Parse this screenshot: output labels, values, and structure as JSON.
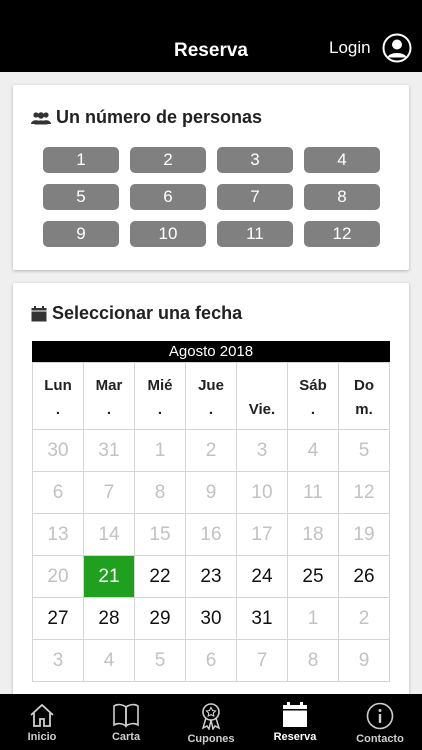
{
  "header": {
    "title": "Reserva",
    "login": "Login"
  },
  "people_section": {
    "title": "Un número de personas",
    "options": [
      "1",
      "2",
      "3",
      "4",
      "5",
      "6",
      "7",
      "8",
      "9",
      "10",
      "11",
      "12"
    ]
  },
  "date_section": {
    "title": "Seleccionar una fecha",
    "month": "Agosto 2018",
    "weekdays": [
      {
        "l1": "Lun",
        "l2": "."
      },
      {
        "l1": "Mar",
        "l2": "."
      },
      {
        "l1": "Mié",
        "l2": "."
      },
      {
        "l1": "Jue",
        "l2": "."
      },
      {
        "l1": "",
        "l2": "Vie."
      },
      {
        "l1": "Sáb",
        "l2": "."
      },
      {
        "l1": "Do",
        "l2": "m."
      }
    ],
    "weeks": [
      [
        {
          "d": "30",
          "s": "dim"
        },
        {
          "d": "31",
          "s": "dim"
        },
        {
          "d": "1",
          "s": "dim"
        },
        {
          "d": "2",
          "s": "dim"
        },
        {
          "d": "3",
          "s": "dim"
        },
        {
          "d": "4",
          "s": "dim"
        },
        {
          "d": "5",
          "s": "dim"
        }
      ],
      [
        {
          "d": "6",
          "s": "dim"
        },
        {
          "d": "7",
          "s": "dim"
        },
        {
          "d": "8",
          "s": "dim"
        },
        {
          "d": "9",
          "s": "dim"
        },
        {
          "d": "10",
          "s": "dim"
        },
        {
          "d": "11",
          "s": "dim"
        },
        {
          "d": "12",
          "s": "dim"
        }
      ],
      [
        {
          "d": "13",
          "s": "dim"
        },
        {
          "d": "14",
          "s": "dim"
        },
        {
          "d": "15",
          "s": "dim"
        },
        {
          "d": "16",
          "s": "dim"
        },
        {
          "d": "17",
          "s": "dim"
        },
        {
          "d": "18",
          "s": "dim"
        },
        {
          "d": "19",
          "s": "dim"
        }
      ],
      [
        {
          "d": "20",
          "s": "dim"
        },
        {
          "d": "21",
          "s": "selected"
        },
        {
          "d": "22",
          "s": "normal"
        },
        {
          "d": "23",
          "s": "normal"
        },
        {
          "d": "24",
          "s": "normal"
        },
        {
          "d": "25",
          "s": "normal"
        },
        {
          "d": "26",
          "s": "normal"
        }
      ],
      [
        {
          "d": "27",
          "s": "normal"
        },
        {
          "d": "28",
          "s": "normal"
        },
        {
          "d": "29",
          "s": "normal"
        },
        {
          "d": "30",
          "s": "normal"
        },
        {
          "d": "31",
          "s": "normal"
        },
        {
          "d": "1",
          "s": "dim"
        },
        {
          "d": "2",
          "s": "dim"
        }
      ],
      [
        {
          "d": "3",
          "s": "dim"
        },
        {
          "d": "4",
          "s": "dim"
        },
        {
          "d": "5",
          "s": "dim"
        },
        {
          "d": "6",
          "s": "dim"
        },
        {
          "d": "7",
          "s": "dim"
        },
        {
          "d": "8",
          "s": "dim"
        },
        {
          "d": "9",
          "s": "dim"
        }
      ]
    ]
  },
  "tabs": [
    {
      "label": "Inicio",
      "icon": "home-icon"
    },
    {
      "label": "Carta",
      "icon": "book-icon"
    },
    {
      "label": "Cupones",
      "icon": "badge-icon"
    },
    {
      "label": "Reserva",
      "icon": "calendar-icon",
      "active": true
    },
    {
      "label": "Contacto",
      "icon": "info-icon"
    }
  ],
  "colors": {
    "selected_day": "#1fa01f",
    "button_gray": "#808080",
    "bar_black": "#000000"
  }
}
